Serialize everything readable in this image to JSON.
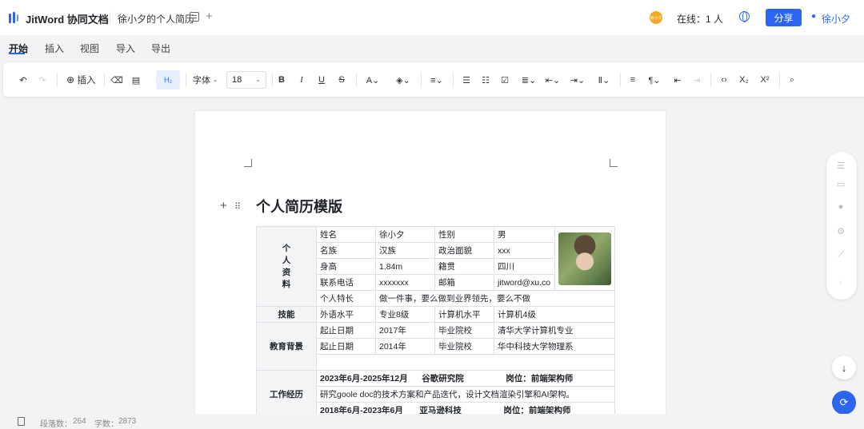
{
  "header": {
    "app_title": "JitWord 协同文档",
    "doc_name": "徐小夕的个人简历",
    "new_tab": "+",
    "avatar_text": "徐小夕",
    "online": "在线：1 人",
    "share": "分享",
    "user": "徐小夕"
  },
  "menu": {
    "tabs": [
      "开始",
      "插入",
      "视图",
      "导入",
      "导出"
    ],
    "active": "开始"
  },
  "toolbar": {
    "insert": "插入",
    "heading": "H₂",
    "font": "字体",
    "font_size": "18",
    "bold": "B",
    "italic": "I",
    "underline": "U",
    "strike": "S",
    "subscript": "X₂",
    "superscript": "X²"
  },
  "document": {
    "title": "个人简历模版",
    "personal_label": "个\n人\n资\n料",
    "rows": {
      "r1": [
        "姓名",
        "徐小夕",
        "性别",
        "男"
      ],
      "r2": [
        "名族",
        "汉族",
        "政治面貌",
        "xxx"
      ],
      "r3": [
        "身高",
        "1.84m",
        "籍贯",
        "四川"
      ],
      "r4": [
        "联系电话",
        "xxxxxxx",
        "邮箱",
        "jitword@xu.co"
      ],
      "r5": [
        "个人特长",
        "做一件事，要么做到业界领先，要么不做"
      ]
    },
    "skills": {
      "label": "技能",
      "cells": [
        "外语水平",
        "专业8级",
        "计算机水平",
        "计算机4级"
      ]
    },
    "education": {
      "label": "教育背景",
      "rows": [
        [
          "起止日期",
          "2017年",
          "毕业院校",
          "清华大学计算机专业"
        ],
        [
          "起止日期",
          "2014年",
          "毕业院校",
          "华中科技大学物理系"
        ]
      ]
    },
    "work": {
      "label": "工作经历",
      "entries": [
        "2023年6月-2025年12月      谷歌研究院                  岗位：前端架构师",
        "研究goole doc的技术方案和产品迭代，设计文档渲染引擎和AI架构。",
        "2018年6月-2023年6月       亚马逊科技                  岗位：前端架构师"
      ]
    }
  },
  "status": {
    "paragraphs_label": "段落数：",
    "paragraphs": "264",
    "words_label": "字数：",
    "words": "2873"
  },
  "colors": {
    "accent": "#2b65f0",
    "avatar": "#f5a623"
  }
}
